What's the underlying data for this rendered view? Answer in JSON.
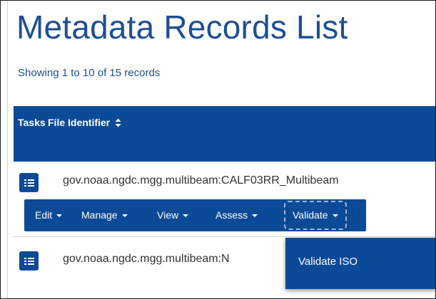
{
  "page": {
    "title": "Metadata Records List",
    "showing_text": "Showing 1 to 10 of 15 records"
  },
  "table": {
    "headers": {
      "tasks": "Tasks",
      "file_identifier": "File Identifier"
    },
    "rows": [
      {
        "file_identifier": "gov.noaa.ngdc.mgg.multibeam:CALF03RR_Multibeam"
      },
      {
        "file_identifier": "gov.noaa.ngdc.mgg.multibeam:N"
      }
    ]
  },
  "actions": {
    "edit": "Edit",
    "manage": "Manage",
    "view": "View",
    "assess": "Assess",
    "validate": "Validate"
  },
  "validate_menu": {
    "items": [
      "Validate ISO"
    ]
  },
  "colors": {
    "primary": "#0b4a97",
    "title": "#1f4f96",
    "focus_outline": "#9fb7d6"
  },
  "icons": {
    "task": "list-icon",
    "sort": "sort-icon",
    "dropdown": "caret-down-icon"
  }
}
